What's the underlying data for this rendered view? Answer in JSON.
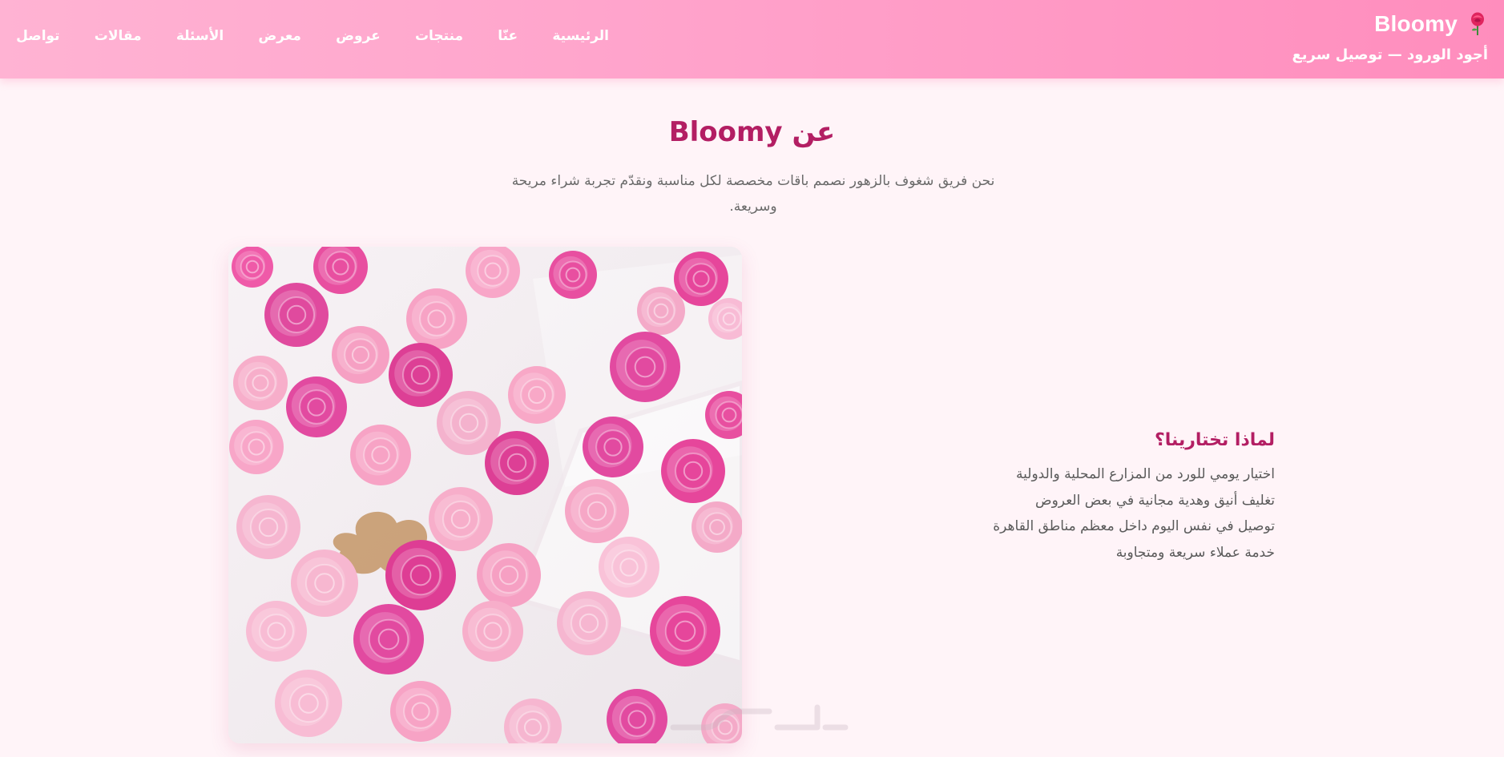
{
  "header": {
    "brand_name": "Bloomy",
    "brand_icon": "rose-icon",
    "tagline": "أجود الورود — توصيل سريع",
    "nav": [
      {
        "label": "الرئيسية"
      },
      {
        "label": "عنّا"
      },
      {
        "label": "منتجات"
      },
      {
        "label": "عروض"
      },
      {
        "label": "معرض"
      },
      {
        "label": "الأسئلة"
      },
      {
        "label": "مقالات"
      },
      {
        "label": "تواصل"
      }
    ]
  },
  "about": {
    "title": "عن Bloomy",
    "text": "نحن فريق شغوف بالزهور نصمم باقات مخصصة لكل مناسبة ونقدّم تجربة شراء مريحة وسريعة.",
    "image_subject": "pink-roses-photo"
  },
  "why": {
    "title": "لماذا تختارينا؟",
    "items": [
      "اختيار يومي للورد من المزارع المحلية والدولية",
      "تغليف أنيق وهدية مجانية في بعض العروض",
      "توصيل في نفس اليوم داخل معظم مناطق القاهرة",
      "خدمة عملاء سريعة ومتجاوبة"
    ]
  },
  "colors": {
    "header_gradient_start": "#ff8dbd",
    "header_gradient_end": "#ffb3d3",
    "accent": "#b31e63",
    "page_background": "#fff4f8",
    "body_text": "#5a5a5a"
  }
}
